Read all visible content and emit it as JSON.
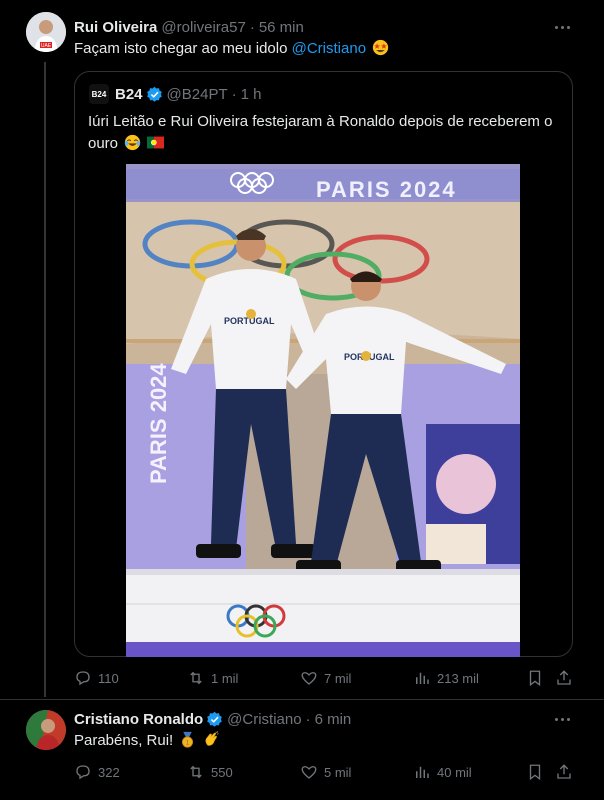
{
  "tweet1": {
    "name": "Rui Oliveira",
    "handle": "@roliveira57",
    "time": "56 min",
    "text_prefix": "Façam isto chegar ao meu idolo ",
    "mention": "@Cristiano",
    "emoji": "star-struck",
    "quote": {
      "avatar_label": "B24",
      "name": "B24",
      "handle": "@B24PT",
      "time": "1 h",
      "text": "Iúri Leitão e Rui Oliveira festejaram à Ronaldo depois de receberem o ouro",
      "emojis": [
        "joy",
        "flag-portugal"
      ],
      "image": {
        "banner_text": "PARIS 2024",
        "side_text": "PARIS 2024",
        "jersey_text": "PORTUGAL"
      }
    },
    "actions": {
      "replies": "110",
      "reposts": "1 mil",
      "likes": "7 mil",
      "views": "213 mil"
    }
  },
  "tweet2": {
    "name": "Cristiano Ronaldo",
    "handle": "@Cristiano",
    "time": "6 min",
    "text": "Parabéns, Rui!",
    "emojis": [
      "medal",
      "clap"
    ],
    "actions": {
      "replies": "322",
      "reposts": "550",
      "likes": "5 mil",
      "views": "40 mil"
    }
  },
  "colors": {
    "background": "#000000",
    "text": "#e7e9ea",
    "muted": "#71767b",
    "accent": "#1d9bf0",
    "border": "#2f3336"
  }
}
